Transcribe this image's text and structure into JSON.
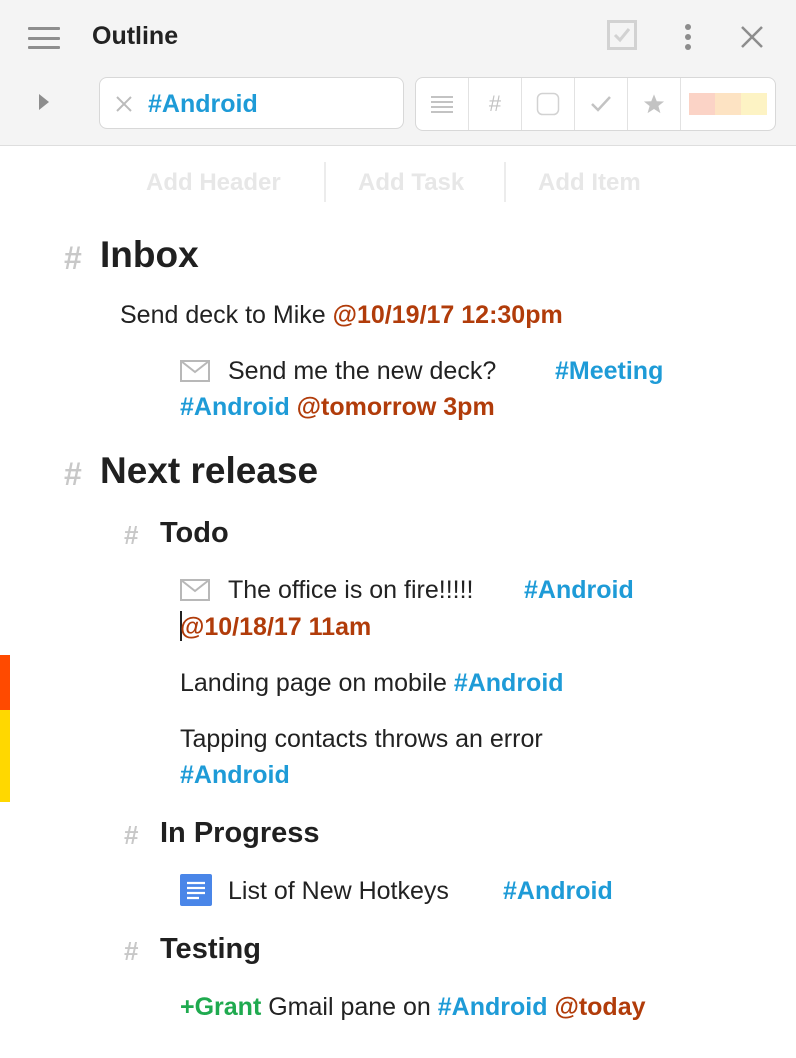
{
  "header": {
    "title": "Outline"
  },
  "search": {
    "value": "#Android"
  },
  "filters": {
    "buttons": [
      "list-icon",
      "hash-icon",
      "square-icon",
      "check-icon",
      "star-icon"
    ],
    "hash_label": "#",
    "colors": [
      "#fbd3c6",
      "#fde3c3",
      "#fdf3c4"
    ]
  },
  "add_bar": {
    "header_label": "Add Header",
    "task_label": "Add Task",
    "item_label": "Add Item"
  },
  "outline": {
    "hash": "#",
    "inbox": {
      "title": "Inbox",
      "item1": {
        "text": "Send deck to Mike ",
        "date": "@10/19/17 12:30pm"
      },
      "item2": {
        "text": "Send me the new deck?",
        "tag1": "#Meeting",
        "tag2": "#Android",
        "date": "@tomorrow 3pm"
      }
    },
    "next_release": {
      "title": "Next release",
      "todo": {
        "title": "Todo",
        "item1": {
          "text": "The office is on fire!!!!!",
          "tag": "#Android",
          "date": "@10/18/17 11am"
        },
        "item2": {
          "text": "Landing page on mobile ",
          "tag": "#Android"
        },
        "item3": {
          "text": "Tapping contacts throws an error",
          "tag": "#Android"
        }
      },
      "in_progress": {
        "title": "In Progress",
        "item1": {
          "text": "List of New Hotkeys",
          "tag": "#Android"
        }
      },
      "testing": {
        "title": "Testing",
        "item1": {
          "person": "+Grant",
          "text": " Gmail pane on ",
          "tag": "#Android",
          "date": "@today"
        }
      }
    }
  },
  "colors": {
    "tag": "#1e9bd7",
    "date": "#b13c0a",
    "person": "#1faa4f",
    "priority_high": "#ff4a00",
    "priority_medium": "#ffd800"
  }
}
